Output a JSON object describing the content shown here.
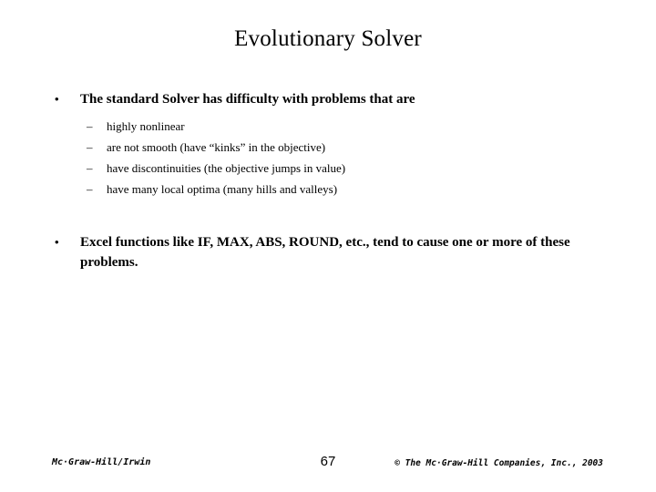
{
  "slide": {
    "title": "Evolutionary Solver",
    "bullets": [
      {
        "marker": "•",
        "text": "The standard Solver has difficulty with problems that are",
        "subbullets": [
          {
            "marker": "–",
            "text": "highly nonlinear"
          },
          {
            "marker": "–",
            "text": "are not smooth (have “kinks” in the objective)"
          },
          {
            "marker": "–",
            "text": "have discontinuities (the objective jumps in value)"
          },
          {
            "marker": "–",
            "text": "have many local optima (many hills and valleys)"
          }
        ]
      },
      {
        "marker": "•",
        "text": "Excel functions like IF, MAX, ABS, ROUND, etc., tend to cause one or more of these problems.",
        "subbullets": []
      }
    ]
  },
  "footer": {
    "publisher": "Mc·Graw-Hill/Irwin",
    "page_number": "67",
    "copyright": "© The Mc·Graw-Hill Companies, Inc., 2003"
  }
}
